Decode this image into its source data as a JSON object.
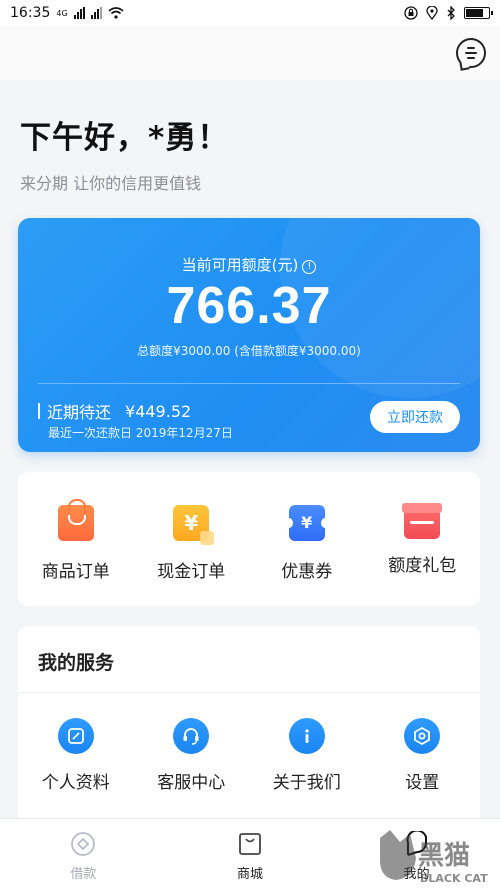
{
  "status_bar": {
    "time": "16:35",
    "network": "4G",
    "battery_level": 0.85
  },
  "header": {
    "greeting": "下午好，*勇！",
    "subtitle": "来分期 让你的信用更值钱"
  },
  "credit_card": {
    "label": "当前可用额度(元)",
    "available_amount": "766.37",
    "total_text": "总额度¥3000.00 (含借款额度¥3000.00)",
    "due_label": "近期待还",
    "due_amount": "¥449.52",
    "last_repay_text": "最近一次还款日 2019年12月27日",
    "repay_button": "立即还款"
  },
  "quick_actions": [
    {
      "label": "商品订单",
      "icon": "shopping-bag-icon"
    },
    {
      "label": "现金订单",
      "icon": "cash-yen-icon"
    },
    {
      "label": "优惠券",
      "icon": "coupon-icon"
    },
    {
      "label": "额度礼包",
      "icon": "gift-icon"
    }
  ],
  "services": {
    "title": "我的服务",
    "items": [
      {
        "label": "个人资料",
        "icon": "edit-icon"
      },
      {
        "label": "客服中心",
        "icon": "headset-icon"
      },
      {
        "label": "关于我们",
        "icon": "info-icon"
      },
      {
        "label": "设置",
        "icon": "settings-icon"
      }
    ]
  },
  "tab_bar": [
    {
      "label": "借款",
      "icon": "loan-icon",
      "active": false
    },
    {
      "label": "商城",
      "icon": "mall-icon",
      "active": true
    },
    {
      "label": "我的",
      "icon": "profile-icon",
      "active": true
    }
  ],
  "watermark": {
    "text": "黑猫",
    "subtext": "BLACK CAT"
  },
  "colors": {
    "primary": "#1f8ff4",
    "background": "#f4f5f7",
    "inactive_tab": "#a7abb2"
  }
}
